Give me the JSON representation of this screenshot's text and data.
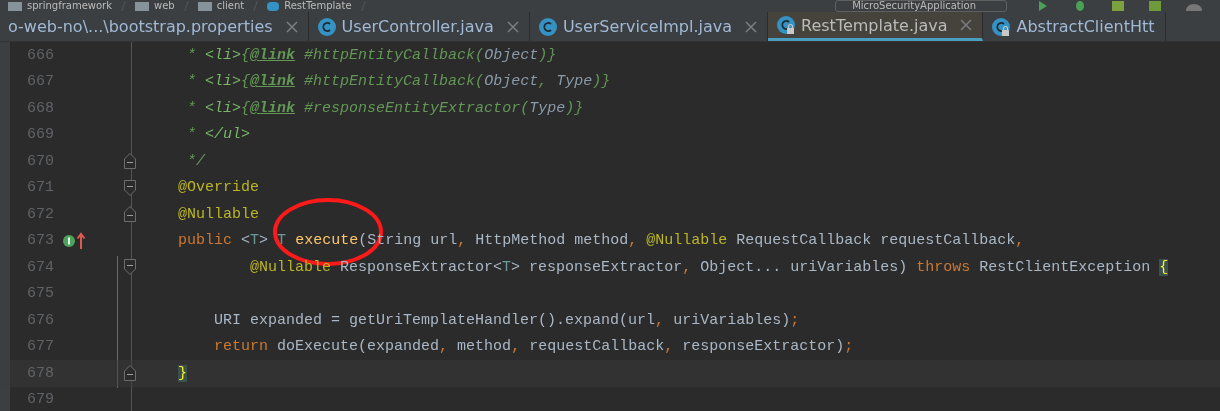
{
  "navbar": {
    "breadcrumbs": [
      {
        "label": "springframework",
        "kind": "folder"
      },
      {
        "label": "web",
        "kind": "folder"
      },
      {
        "label": "client",
        "kind": "folder"
      },
      {
        "label": "RestTemplate",
        "kind": "class"
      }
    ],
    "run_config": "MicroSecurityApplication"
  },
  "tabs": [
    {
      "label": "o-web-no\\...\\bootstrap.properties",
      "kind": "file",
      "locked": false,
      "selected": false,
      "closable": true
    },
    {
      "label": "UserController.java",
      "kind": "class",
      "locked": false,
      "selected": false,
      "closable": true
    },
    {
      "label": "UserServiceImpl.java",
      "kind": "class",
      "locked": false,
      "selected": false,
      "closable": true
    },
    {
      "label": "RestTemplate.java",
      "kind": "class",
      "locked": true,
      "selected": true,
      "closable": true
    },
    {
      "label": "AbstractClientHtt",
      "kind": "class",
      "locked": true,
      "selected": false,
      "closable": false
    }
  ],
  "editor": {
    "lines": [
      {
        "number": "666",
        "fold_start": false,
        "fold_end": false,
        "override_marker": false,
        "current": false,
        "tokens": [
          {
            "text": "     * ",
            "kind": "doc"
          },
          {
            "text": "<li>",
            "kind": "doctag"
          },
          {
            "text": "{",
            "kind": "doc"
          },
          {
            "text": "@link",
            "kind": "link"
          },
          {
            "text": " #httpEntityCallback(",
            "kind": "doc"
          },
          {
            "text": "Object",
            "kind": "docref"
          },
          {
            "text": ")}",
            "kind": "doc"
          }
        ]
      },
      {
        "number": "667",
        "fold_start": false,
        "fold_end": false,
        "override_marker": false,
        "current": false,
        "tokens": [
          {
            "text": "     * ",
            "kind": "doc"
          },
          {
            "text": "<li>",
            "kind": "doctag"
          },
          {
            "text": "{",
            "kind": "doc"
          },
          {
            "text": "@link",
            "kind": "link"
          },
          {
            "text": " #httpEntityCallback(",
            "kind": "doc"
          },
          {
            "text": "Object",
            "kind": "docref"
          },
          {
            "text": ", ",
            "kind": "doc"
          },
          {
            "text": "Type",
            "kind": "docref"
          },
          {
            "text": ")}",
            "kind": "doc"
          }
        ]
      },
      {
        "number": "668",
        "fold_start": false,
        "fold_end": false,
        "override_marker": false,
        "current": false,
        "tokens": [
          {
            "text": "     * ",
            "kind": "doc"
          },
          {
            "text": "<li>",
            "kind": "doctag"
          },
          {
            "text": "{",
            "kind": "doc"
          },
          {
            "text": "@link",
            "kind": "link"
          },
          {
            "text": " #responseEntityExtractor(",
            "kind": "doc"
          },
          {
            "text": "Type",
            "kind": "docref"
          },
          {
            "text": ")}",
            "kind": "doc"
          }
        ]
      },
      {
        "number": "669",
        "fold_start": false,
        "fold_end": false,
        "override_marker": false,
        "current": false,
        "tokens": [
          {
            "text": "     * ",
            "kind": "doc"
          },
          {
            "text": "</ul>",
            "kind": "doctag"
          }
        ]
      },
      {
        "number": "670",
        "fold_start": false,
        "fold_end": true,
        "override_marker": false,
        "current": false,
        "tokens": [
          {
            "text": "     */",
            "kind": "doc"
          }
        ]
      },
      {
        "number": "671",
        "fold_start": true,
        "fold_end": false,
        "override_marker": false,
        "current": false,
        "tokens": [
          {
            "text": "    @Override",
            "kind": "ann"
          }
        ]
      },
      {
        "number": "672",
        "fold_start": false,
        "fold_end": true,
        "override_marker": false,
        "current": false,
        "tokens": [
          {
            "text": "    @Nullable",
            "kind": "ann"
          }
        ]
      },
      {
        "number": "673",
        "fold_start": false,
        "fold_end": false,
        "override_marker": true,
        "current": false,
        "tokens": [
          {
            "text": "    public",
            "kind": "kw"
          },
          {
            "text": " <",
            "kind": "plain"
          },
          {
            "text": "T",
            "kind": "generic"
          },
          {
            "text": "> ",
            "kind": "plain"
          },
          {
            "text": "T",
            "kind": "generic"
          },
          {
            "text": " execute",
            "kind": "fn"
          },
          {
            "text": "(String url",
            "kind": "plain"
          },
          {
            "text": ",",
            "kind": "kw"
          },
          {
            "text": " HttpMethod method",
            "kind": "plain"
          },
          {
            "text": ",",
            "kind": "kw"
          },
          {
            "text": " @Nullable",
            "kind": "ann"
          },
          {
            "text": " RequestCallback requestCallback",
            "kind": "plain"
          },
          {
            "text": ",",
            "kind": "kw"
          }
        ]
      },
      {
        "number": "674",
        "fold_start": true,
        "fold_end": false,
        "override_marker": false,
        "current": false,
        "tokens": [
          {
            "text": "            @Nullable",
            "kind": "ann"
          },
          {
            "text": " ResponseExtractor<",
            "kind": "plain"
          },
          {
            "text": "T",
            "kind": "generic"
          },
          {
            "text": "> responseExtractor",
            "kind": "plain"
          },
          {
            "text": ",",
            "kind": "kw"
          },
          {
            "text": " Object... uriVariables) ",
            "kind": "plain"
          },
          {
            "text": "throws",
            "kind": "kw"
          },
          {
            "text": " RestClientException ",
            "kind": "plain"
          },
          {
            "text": "{",
            "kind": "brace"
          }
        ]
      },
      {
        "number": "675",
        "fold_start": false,
        "fold_end": false,
        "override_marker": false,
        "current": false
      },
      {
        "number": "676",
        "fold_start": false,
        "fold_end": false,
        "override_marker": false,
        "current": false,
        "tokens": [
          {
            "text": "        URI expanded = getUriTemplateHandler().expand(url",
            "kind": "plain"
          },
          {
            "text": ",",
            "kind": "kw"
          },
          {
            "text": " uriVariables)",
            "kind": "plain"
          },
          {
            "text": ";",
            "kind": "kw"
          }
        ]
      },
      {
        "number": "677",
        "fold_start": false,
        "fold_end": false,
        "override_marker": false,
        "current": false,
        "tokens": [
          {
            "text": "        return",
            "kind": "kw"
          },
          {
            "text": " doExecute(expanded",
            "kind": "plain"
          },
          {
            "text": ",",
            "kind": "kw"
          },
          {
            "text": " method",
            "kind": "plain"
          },
          {
            "text": ",",
            "kind": "kw"
          },
          {
            "text": " requestCallback",
            "kind": "plain"
          },
          {
            "text": ",",
            "kind": "kw"
          },
          {
            "text": " responseExtractor)",
            "kind": "plain"
          },
          {
            "text": ";",
            "kind": "kw"
          }
        ]
      },
      {
        "number": "678",
        "fold_start": false,
        "fold_end": true,
        "override_marker": false,
        "current": true,
        "tokens": [
          {
            "text": "    }",
            "kind": "brace"
          }
        ]
      },
      {
        "number": "679",
        "fold_start": false,
        "fold_end": false,
        "override_marker": false,
        "current": false
      }
    ]
  }
}
